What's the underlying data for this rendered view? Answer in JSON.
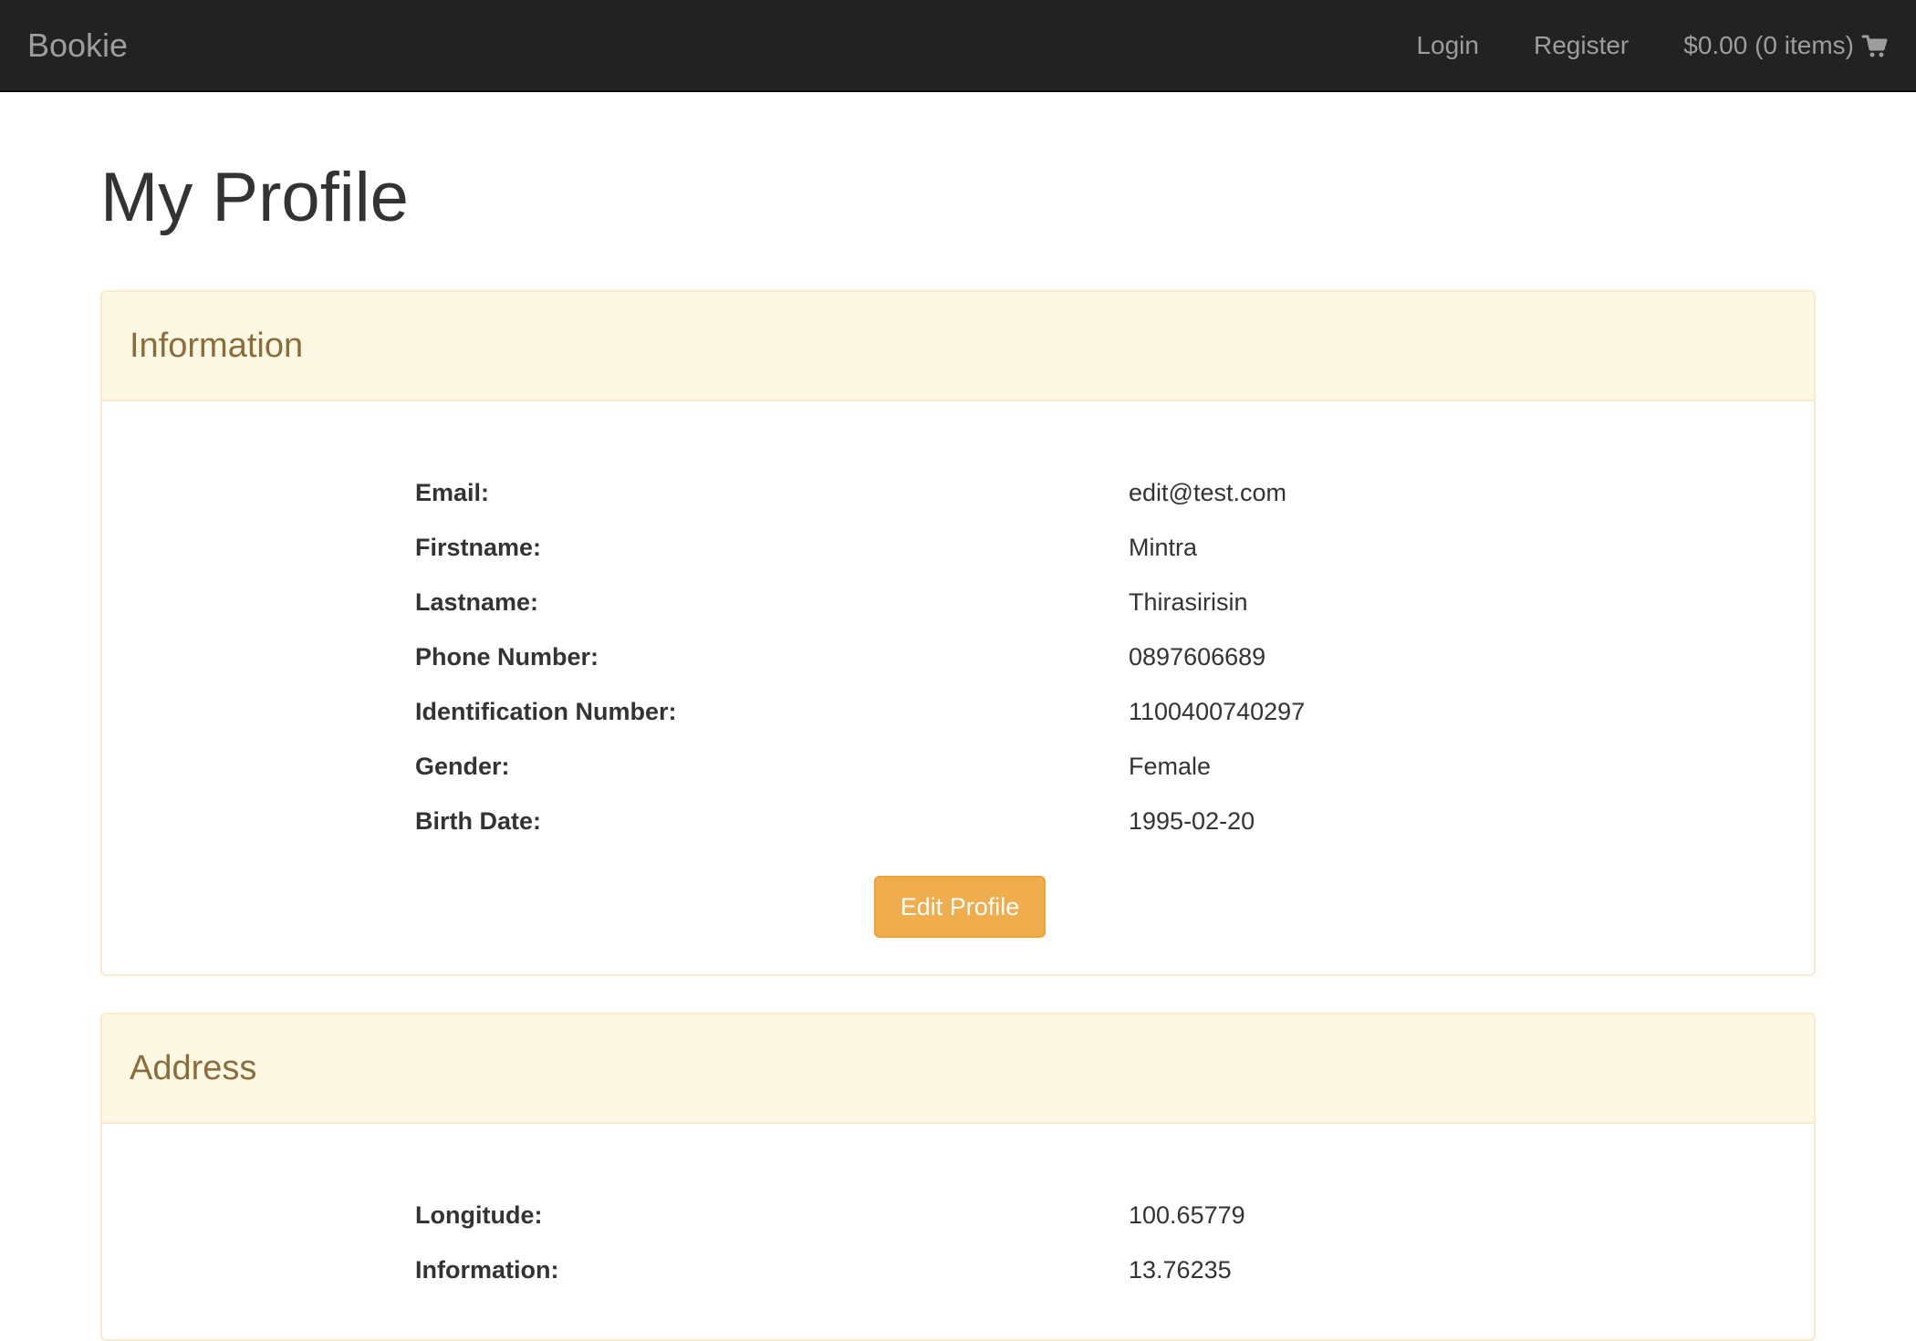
{
  "navbar": {
    "brand": "Bookie",
    "login": "Login",
    "register": "Register",
    "cart": "$0.00 (0 items)",
    "cart_icon": "shopping-cart-icon"
  },
  "page": {
    "title": "My Profile"
  },
  "information": {
    "title": "Information",
    "rows": [
      {
        "label": "Email:",
        "value": "edit@test.com"
      },
      {
        "label": "Firstname:",
        "value": "Mintra"
      },
      {
        "label": "Lastname:",
        "value": "Thirasirisin"
      },
      {
        "label": "Phone Number:",
        "value": "0897606689"
      },
      {
        "label": "Identification Number:",
        "value": "1100400740297"
      },
      {
        "label": "Gender:",
        "value": "Female"
      },
      {
        "label": "Birth Date:",
        "value": "1995-02-20"
      }
    ],
    "edit_button": "Edit Profile"
  },
  "address": {
    "title": "Address",
    "rows": [
      {
        "label": "Longitude:",
        "value": "100.65779"
      },
      {
        "label": "Information:",
        "value": "13.76235"
      }
    ]
  }
}
